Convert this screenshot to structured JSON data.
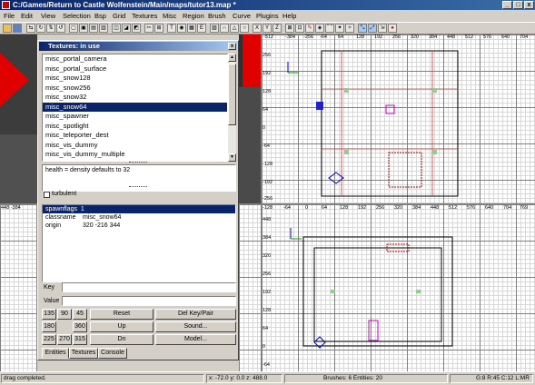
{
  "window": {
    "title": "C:/Games/Return to Castle Wolfenstein/Main/maps/tutor13.map *"
  },
  "menu": [
    "File",
    "Edit",
    "View",
    "Selection",
    "Bsp",
    "Grid",
    "Textures",
    "Misc",
    "Region",
    "Brush",
    "Curve",
    "Plugins",
    "Help"
  ],
  "textures_dialog": {
    "title": "Textures: in use",
    "items": [
      "misc_portal_camera",
      "misc_portal_surface",
      "misc_snow128",
      "misc_snow256",
      "misc_snow32",
      "misc_snow64",
      "misc_spawner",
      "misc_spotlight",
      "misc_teleporter_dest",
      "misc_vis_dummy",
      "misc_vis_dummy_multiple"
    ],
    "selected_index": 5,
    "description": "health = density defaults to 32",
    "checkbox_label": "turbulent",
    "props": [
      {
        "key": "spawnflags",
        "value": "1"
      },
      {
        "key": "classname",
        "value": "misc_snow64"
      },
      {
        "key": "origin",
        "value": "320 -216 344"
      }
    ],
    "key_label": "Key",
    "value_label": "Value",
    "angles": [
      "135",
      "90",
      "45",
      "180",
      "360",
      "225",
      "270",
      "315"
    ],
    "buttons": {
      "reset": "Reset",
      "up": "Up",
      "dn": "Dn",
      "del_key_pair": "Del Key/Pair",
      "sound": "Sound...",
      "model": "Model..."
    },
    "tabs": [
      "Entities",
      "Textures",
      "Console"
    ]
  },
  "top_ruler": [
    "-512",
    "-448",
    "-384",
    "-320",
    "-256",
    "-192",
    "-128",
    "-64",
    "0",
    "64",
    "128",
    "192",
    "256",
    "320",
    "384",
    "448",
    "512",
    "576",
    "640",
    "704",
    "768"
  ],
  "left_ruler_top": [
    "256",
    "192",
    "128",
    "64",
    "0",
    "-64",
    "-128",
    "-192",
    "-256"
  ],
  "bottom_ruler": [
    "-128",
    "-64",
    "0",
    "64",
    "128",
    "192",
    "256",
    "320",
    "384",
    "448",
    "512",
    "576",
    "640",
    "704",
    "769",
    "832"
  ],
  "left_ruler_bottom": [
    "448",
    "384",
    "320",
    "256",
    "192",
    "128",
    "64",
    "0",
    "-64"
  ],
  "bottom_left_ruler": [
    "448",
    "-384",
    "-320",
    "-256",
    "-192",
    "-128",
    "-64"
  ],
  "status": {
    "message": "drag completed.",
    "coords": "x: -72.0  y: 0.0  z: 488.0",
    "counts": "Brushes: 6 Entities: 20",
    "grid": "G:8 R:45 C:12 L:MR"
  }
}
